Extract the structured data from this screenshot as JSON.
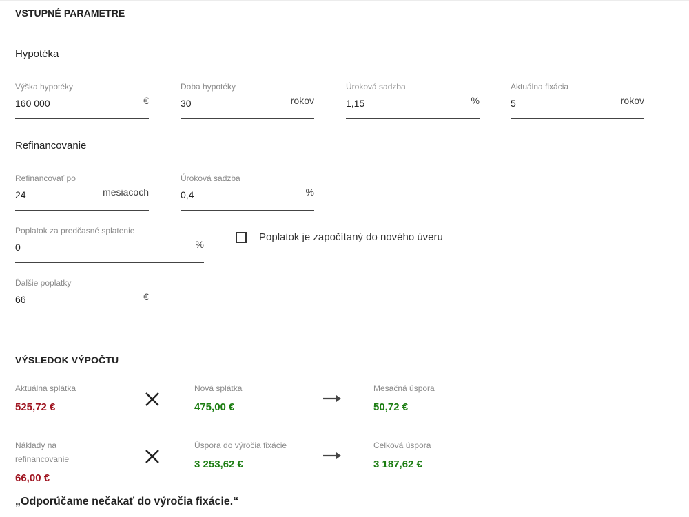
{
  "input_section": {
    "title": "VSTUPNÉ PARAMETRE",
    "mortgage": {
      "heading": "Hypotéka",
      "amount": {
        "label": "Výška hypotéky",
        "value": "160 000",
        "unit": "€"
      },
      "term": {
        "label": "Doba hypotéky",
        "value": "30",
        "unit": "rokov"
      },
      "rate": {
        "label": "Úroková sadzba",
        "value": "1,15",
        "unit": "%"
      },
      "fixation": {
        "label": "Aktuálna fixácia",
        "value": "5",
        "unit": "rokov"
      }
    },
    "refinancing": {
      "heading": "Refinancovanie",
      "after": {
        "label": "Refinancovať po",
        "value": "24",
        "unit": "mesiacoch"
      },
      "rate": {
        "label": "Úroková sadzba",
        "value": "0,4",
        "unit": "%"
      },
      "early_fee": {
        "label": "Poplatok za predčasné splatenie",
        "value": "0",
        "unit": "%"
      },
      "fee_included": {
        "label": "Poplatok je započítaný do nového úveru",
        "checked": false
      },
      "other_fees": {
        "label": "Ďalšie poplatky",
        "value": "66",
        "unit": "€"
      }
    }
  },
  "result_section": {
    "title": "VÝSLEDOK VÝPOČTU",
    "row1": {
      "current_payment": {
        "label": "Aktuálna splátka",
        "value": "525,72 €"
      },
      "new_payment": {
        "label": "Nová splátka",
        "value": "475,00 €"
      },
      "monthly_saving": {
        "label": "Mesačná úspora",
        "value": "50,72 €"
      }
    },
    "row2": {
      "refi_costs": {
        "label_line1": "Náklady na",
        "label_line2": "refinancovanie",
        "value": "66,00 €"
      },
      "saving_to_fixation": {
        "label": "Úspora do výročia fixácie",
        "value": "3 253,62 €"
      },
      "total_saving": {
        "label": "Celková úspora",
        "value": "3 187,62 €"
      }
    },
    "recommendation": "„Odporúčame nečakať do výročia fixácie.“"
  },
  "icons": {
    "operator": "times-icon",
    "result": "arrow-right-icon"
  },
  "colors": {
    "negative": "#a01622",
    "positive": "#1c7d12",
    "underline": "#444444"
  }
}
